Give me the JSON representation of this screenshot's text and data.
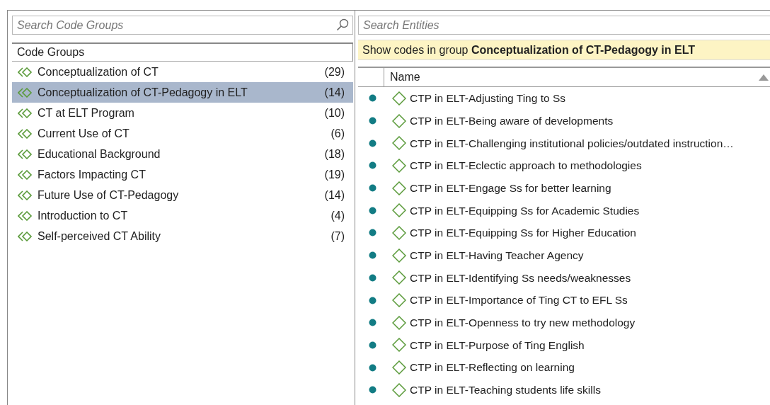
{
  "left_panel": {
    "search": {
      "placeholder": "Search Code Groups"
    },
    "column_header": "Code Groups",
    "groups": [
      {
        "name": "Conceptualization of CT",
        "count": "(29)",
        "selected": false
      },
      {
        "name": "Conceptualization of CT-Pedagogy in ELT",
        "count": "(14)",
        "selected": true
      },
      {
        "name": "CT at ELT Program",
        "count": "(10)",
        "selected": false
      },
      {
        "name": "Current Use of CT",
        "count": "(6)",
        "selected": false
      },
      {
        "name": "Educational Background",
        "count": "(18)",
        "selected": false
      },
      {
        "name": "Factors Impacting CT",
        "count": "(19)",
        "selected": false
      },
      {
        "name": "Future Use of CT-Pedagogy",
        "count": "(14)",
        "selected": false
      },
      {
        "name": "Introduction to CT",
        "count": "(4)",
        "selected": false
      },
      {
        "name": "Self-perceived CT Ability",
        "count": "(7)",
        "selected": false
      }
    ]
  },
  "right_panel": {
    "search": {
      "placeholder": "Search Entities"
    },
    "filter_banner": "Show codes in group **Conceptualization of CT-Pedagogy in ELT**",
    "column_header": "Name",
    "codes": [
      "CTP in ELT-Adjusting Ting to Ss",
      "CTP in ELT-Being aware of developments",
      "CTP in ELT-Challenging institutional policies/outdated instruction…",
      "CTP in ELT-Eclectic approach to methodologies",
      "CTP in ELT-Engage Ss for better learning",
      "CTP in ELT-Equipping Ss for Academic Studies",
      "CTP in ELT-Equipping Ss for Higher Education",
      "CTP in ELT-Having Teacher Agency",
      "CTP in ELT-Identifying Ss needs/weaknesses",
      "CTP in ELT-Importance of Ting CT to EFL Ss",
      "CTP in ELT-Openness to try new methodology",
      "CTP in ELT-Purpose of Ting English",
      "CTP in ELT-Reflecting on learning",
      "CTP in ELT-Teaching students life skills"
    ]
  }
}
